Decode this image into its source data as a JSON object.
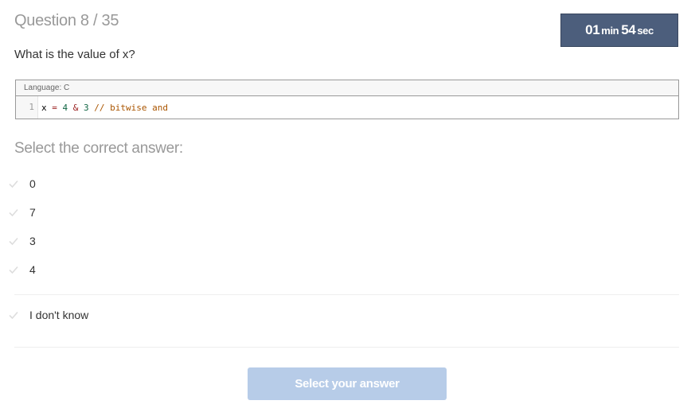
{
  "header": {
    "question_progress": "Question 8 / 35"
  },
  "timer": {
    "minutes": "01",
    "minutes_unit": "min",
    "seconds": "54",
    "seconds_unit": "sec"
  },
  "question": {
    "text": "What is the value of x?"
  },
  "code": {
    "language_label": "Language: C",
    "lines": [
      {
        "number": "1",
        "tokens": {
          "var": "x",
          "assign": "=",
          "left": "4",
          "op": "&",
          "right": "3",
          "comment": "// bitwise and"
        }
      }
    ]
  },
  "answers": {
    "title": "Select the correct answer:",
    "options": [
      {
        "label": "0"
      },
      {
        "label": "7"
      },
      {
        "label": "3"
      },
      {
        "label": "4"
      }
    ],
    "dont_know": "I don't know"
  },
  "submit": {
    "label": "Select your answer"
  },
  "colors": {
    "timer_bg": "#4c5e7c",
    "button_disabled": "#b7cce8",
    "muted_text": "#999999"
  }
}
